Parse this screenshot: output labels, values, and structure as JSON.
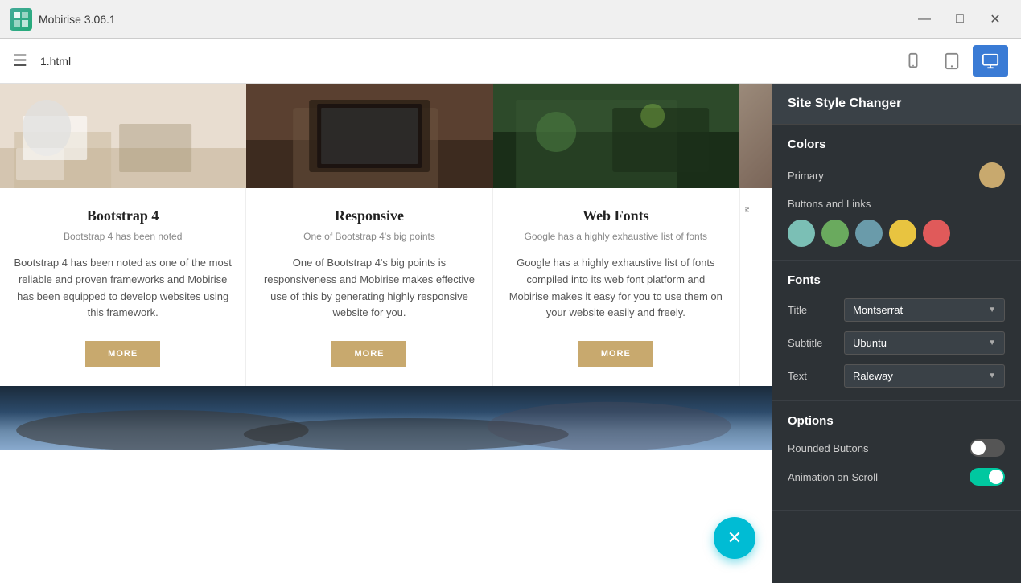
{
  "titleBar": {
    "appName": "Mobirise 3.06.1",
    "logo": "M",
    "minBtn": "—",
    "maxBtn": "□",
    "closeBtn": "✕"
  },
  "toolbar": {
    "hamburger": "☰",
    "fileName": "1.html",
    "viewBtns": [
      {
        "label": "mobile",
        "icon": "mobile",
        "active": false
      },
      {
        "label": "tablet",
        "icon": "tablet",
        "active": false
      },
      {
        "label": "desktop",
        "icon": "desktop",
        "active": true
      }
    ]
  },
  "cards": [
    {
      "title": "Bootstrap 4",
      "subtitle": "Bootstrap 4 has been noted",
      "text": "Bootstrap 4 has been noted as one of the most reliable and proven frameworks and Mobirise has been equipped to develop websites using this framework.",
      "btnLabel": "MORE"
    },
    {
      "title": "Responsive",
      "subtitle": "One of Bootstrap 4's big points",
      "text": "One of Bootstrap 4's big points is responsiveness and Mobirise makes effective use of this by generating highly responsive website for you.",
      "btnLabel": "MORE"
    },
    {
      "title": "Web Fonts",
      "subtitle": "Google has a highly exhaustive list of fonts",
      "text": "Google has a highly exhaustive list of fonts compiled into its web font platform and Mobirise makes it easy for you to use them on your website easily and freely.",
      "btnLabel": "MORE"
    }
  ],
  "sidePanel": {
    "title": "Site Style Changer",
    "sections": {
      "colors": {
        "sectionTitle": "Colors",
        "primaryLabel": "Primary",
        "primaryColor": "#c8a96e",
        "buttonsLinksLabel": "Buttons and Links",
        "colorOptions": [
          "#7bbfb5",
          "#6aaa5e",
          "#6a9baa",
          "#e8c440",
          "#e05a5a"
        ]
      },
      "fonts": {
        "sectionTitle": "Fonts",
        "rows": [
          {
            "label": "Title",
            "value": "Montserrat"
          },
          {
            "label": "Subtitle",
            "value": "Ubuntu"
          },
          {
            "label": "Text",
            "value": "Raleway"
          }
        ]
      },
      "options": {
        "sectionTitle": "Options",
        "rows": [
          {
            "label": "Rounded Buttons",
            "state": "off"
          },
          {
            "label": "Animation on Scroll",
            "state": "on"
          }
        ]
      }
    }
  },
  "fab": {
    "icon": "✕",
    "label": "close-fab"
  }
}
